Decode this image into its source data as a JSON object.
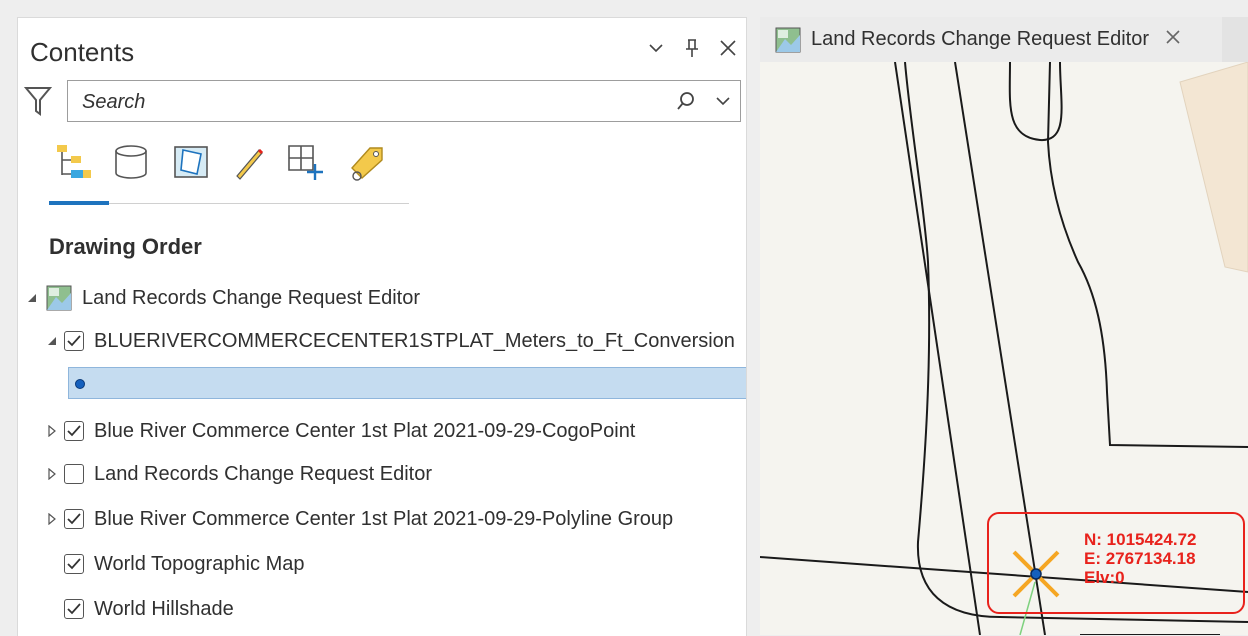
{
  "contents_pane": {
    "title": "Contents",
    "search": {
      "placeholder": "Search",
      "value": ""
    },
    "toolbar": [
      {
        "icon": "list-by-drawing-order-icon",
        "active": true
      },
      {
        "icon": "list-by-data-source-icon",
        "active": false
      },
      {
        "icon": "list-by-selection-icon",
        "active": false
      },
      {
        "icon": "list-by-editing-icon",
        "active": false
      },
      {
        "icon": "list-by-snapping-icon",
        "active": false
      },
      {
        "icon": "list-by-labeling-icon",
        "active": false
      }
    ],
    "section_heading": "Drawing Order",
    "map_item": {
      "label": "Land Records Change Request Editor",
      "icon": "map-icon",
      "expanded": true
    },
    "layers": [
      {
        "label": "BLUERIVERCOMMERCECENTER1STPLAT_Meters_to_Ft_Conversion",
        "checked": true,
        "expanded": true
      },
      {
        "label": "Blue River Commerce Center 1st Plat 2021-09-29-CogoPoint",
        "checked": true,
        "expanded": false
      },
      {
        "label": "Land Records Change Request Editor",
        "checked": false,
        "expanded": false
      },
      {
        "label": "Blue River Commerce Center 1st Plat 2021-09-29-Polyline Group",
        "checked": true,
        "expanded": false
      },
      {
        "label": "World Topographic Map",
        "checked": true
      },
      {
        "label": "World Hillshade",
        "checked": true
      }
    ],
    "legend_symbol": "blue-point-symbol"
  },
  "map_view": {
    "tab_title": "Land Records Change Request Editor",
    "tab_icon": "map-icon",
    "coordinates": {
      "northing": "N: 1015424.72",
      "easting": "E: 2767134.18",
      "elevation": "Elv:0"
    },
    "colors": {
      "highlight": "#e8221c",
      "snap_cross": "#f5a623",
      "point": "#1560bd"
    }
  }
}
